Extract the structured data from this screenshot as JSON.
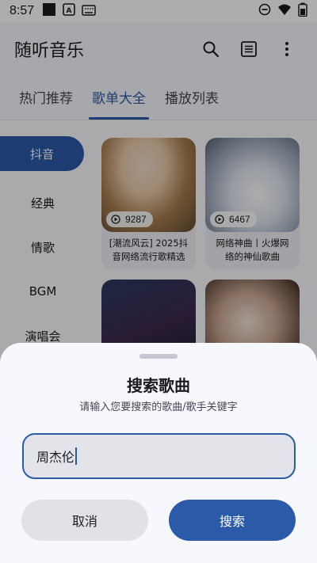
{
  "status_bar": {
    "time": "8:57",
    "icons": [
      "white-square-icon",
      "a-box-icon",
      "keyboard-icon"
    ],
    "right_icons": [
      "dnd-icon",
      "wifi-icon",
      "battery-icon"
    ]
  },
  "app_bar": {
    "title": "随听音乐",
    "actions": [
      "search-icon",
      "list-icon",
      "more-vert-icon"
    ]
  },
  "tabs": [
    {
      "label": "热门推荐"
    },
    {
      "label": "歌单大全",
      "active": true
    },
    {
      "label": "播放列表"
    }
  ],
  "sidebar": {
    "items": [
      {
        "label": "抖音",
        "active": true
      },
      {
        "label": "经典"
      },
      {
        "label": "情歌"
      },
      {
        "label": "BGM"
      },
      {
        "label": "演唱会"
      }
    ]
  },
  "playlists": [
    {
      "plays": "9287",
      "caption": "[潮流风云] 2025抖音网络流行歌精选"
    },
    {
      "plays": "6467",
      "caption": "网络神曲丨火爆网络的神仙歌曲"
    },
    {
      "plays": "",
      "caption": ""
    },
    {
      "plays": "",
      "caption": ""
    }
  ],
  "dialog": {
    "title": "搜索歌曲",
    "subtitle": "请输入您要搜索的歌曲/歌手关键字",
    "input_value": "周杰伦",
    "cancel_label": "取消",
    "confirm_label": "搜索"
  },
  "colors": {
    "accent": "#2b5ba8",
    "surface": "#f7f8fd",
    "input_bg": "#e3e4ea",
    "cancel_bg": "#e1e2e8"
  }
}
